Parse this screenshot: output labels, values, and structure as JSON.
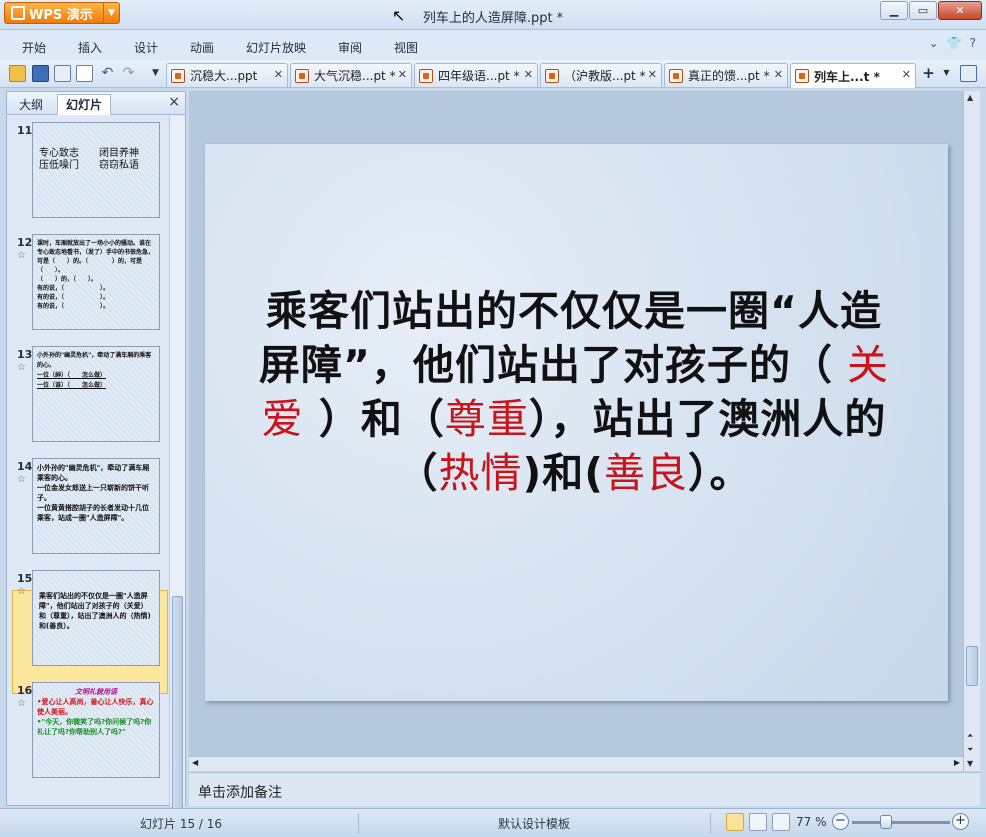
{
  "app": {
    "name": "WPS 演示",
    "window_title": "列车上的人造屏障.ppt *"
  },
  "window_controls": {
    "minimize": "▁",
    "restore": "▭",
    "close": "✕"
  },
  "menu": {
    "items": [
      "开始",
      "插入",
      "设计",
      "动画",
      "幻灯片放映",
      "审阅",
      "视图"
    ],
    "right": [
      "⌄",
      "👕",
      "?"
    ]
  },
  "doc_tabs": [
    {
      "label": "沉稳大...ppt",
      "active": false
    },
    {
      "label": "大气沉稳...pt *",
      "active": false
    },
    {
      "label": "四年级语...pt *",
      "active": false
    },
    {
      "label": "（沪教版...pt *",
      "active": false
    },
    {
      "label": "真正的馈...pt *",
      "active": false
    },
    {
      "label": "列车上...t *",
      "active": true
    }
  ],
  "left_panel": {
    "tabs": [
      "大纲",
      "幻灯片"
    ],
    "active_tab": "幻灯片",
    "close": "×",
    "thumbnails": [
      {
        "num": "11",
        "star": "",
        "lines": [
          "专心致志　　闭目养神",
          "压低噪门　　窃窃私语"
        ]
      },
      {
        "num": "12",
        "star": "☆",
        "lines": [
          "课时，车厢就放出了一场小小的骚动。谁在专心致志地看书，（发了）手中的书很危急，可是（　　）的。（　　　　）的，可是（　　）。",
          "（　　）的，（　　）。",
          "有的说，（　　　　　　）。",
          "有的说，（　　　　　　）。",
          "有的说，（　　　　　　）。"
        ]
      },
      {
        "num": "13",
        "star": "☆",
        "lines": [
          "小外孙的\"幽灵危机\"，牵动了满车厢的乘客的心。",
          "一位（绅）（　　怎么做）",
          "一位（谁）（　　怎么做）"
        ]
      },
      {
        "num": "14",
        "star": "☆",
        "lines": [
          "小外孙的\"幽灵危机\"，牵动了满车厢乘客的心。",
          "一位金发女郎送上一只崭新的饼干听子。",
          "一位黄黄搭腔胡子的长者发动十几位乘客，站成一圈\"人造屏障\"。"
        ]
      },
      {
        "num": "15",
        "star": "☆",
        "lines": [
          "乘客们站出的不仅仅是一圈\"人造屏障\"，他们站出了对孩子的（关爱）和（尊重），站出了澳洲人的（热情)和(善良）。"
        ]
      },
      {
        "num": "16",
        "star": "☆",
        "lines": [
          "文明礼貌用语",
          "•爱心让人高尚，善心让人快乐，真心使人美丽。",
          "•\"今天，你微笑了吗?你问候了吗?你礼让了吗?你帮助别人了吗?\""
        ]
      }
    ],
    "selected": "15"
  },
  "slide": {
    "segments": [
      {
        "t": "乘客们站出的不仅仅是一圈“人造屏障”，他们站出了对孩子的（",
        "red": false
      },
      {
        "t": " 关爱",
        "red": true
      },
      {
        "t": " ）和（",
        "red": false
      },
      {
        "t": "尊重",
        "red": true
      },
      {
        "t": "），站出了澳洲人的（",
        "red": false
      },
      {
        "t": "热情",
        "red": true
      },
      {
        "t": ")和(",
        "red": false
      },
      {
        "t": "善良",
        "red": true
      },
      {
        "t": "）。",
        "red": false
      }
    ],
    "text_color": "#111111",
    "accent_color": "#c8141a"
  },
  "notes_placeholder": "单击添加备注",
  "status": {
    "slide_info": "幻灯片 15 / 16",
    "template": "默认设计模板",
    "zoom": "77 %",
    "zoom_level_percent": 77
  }
}
